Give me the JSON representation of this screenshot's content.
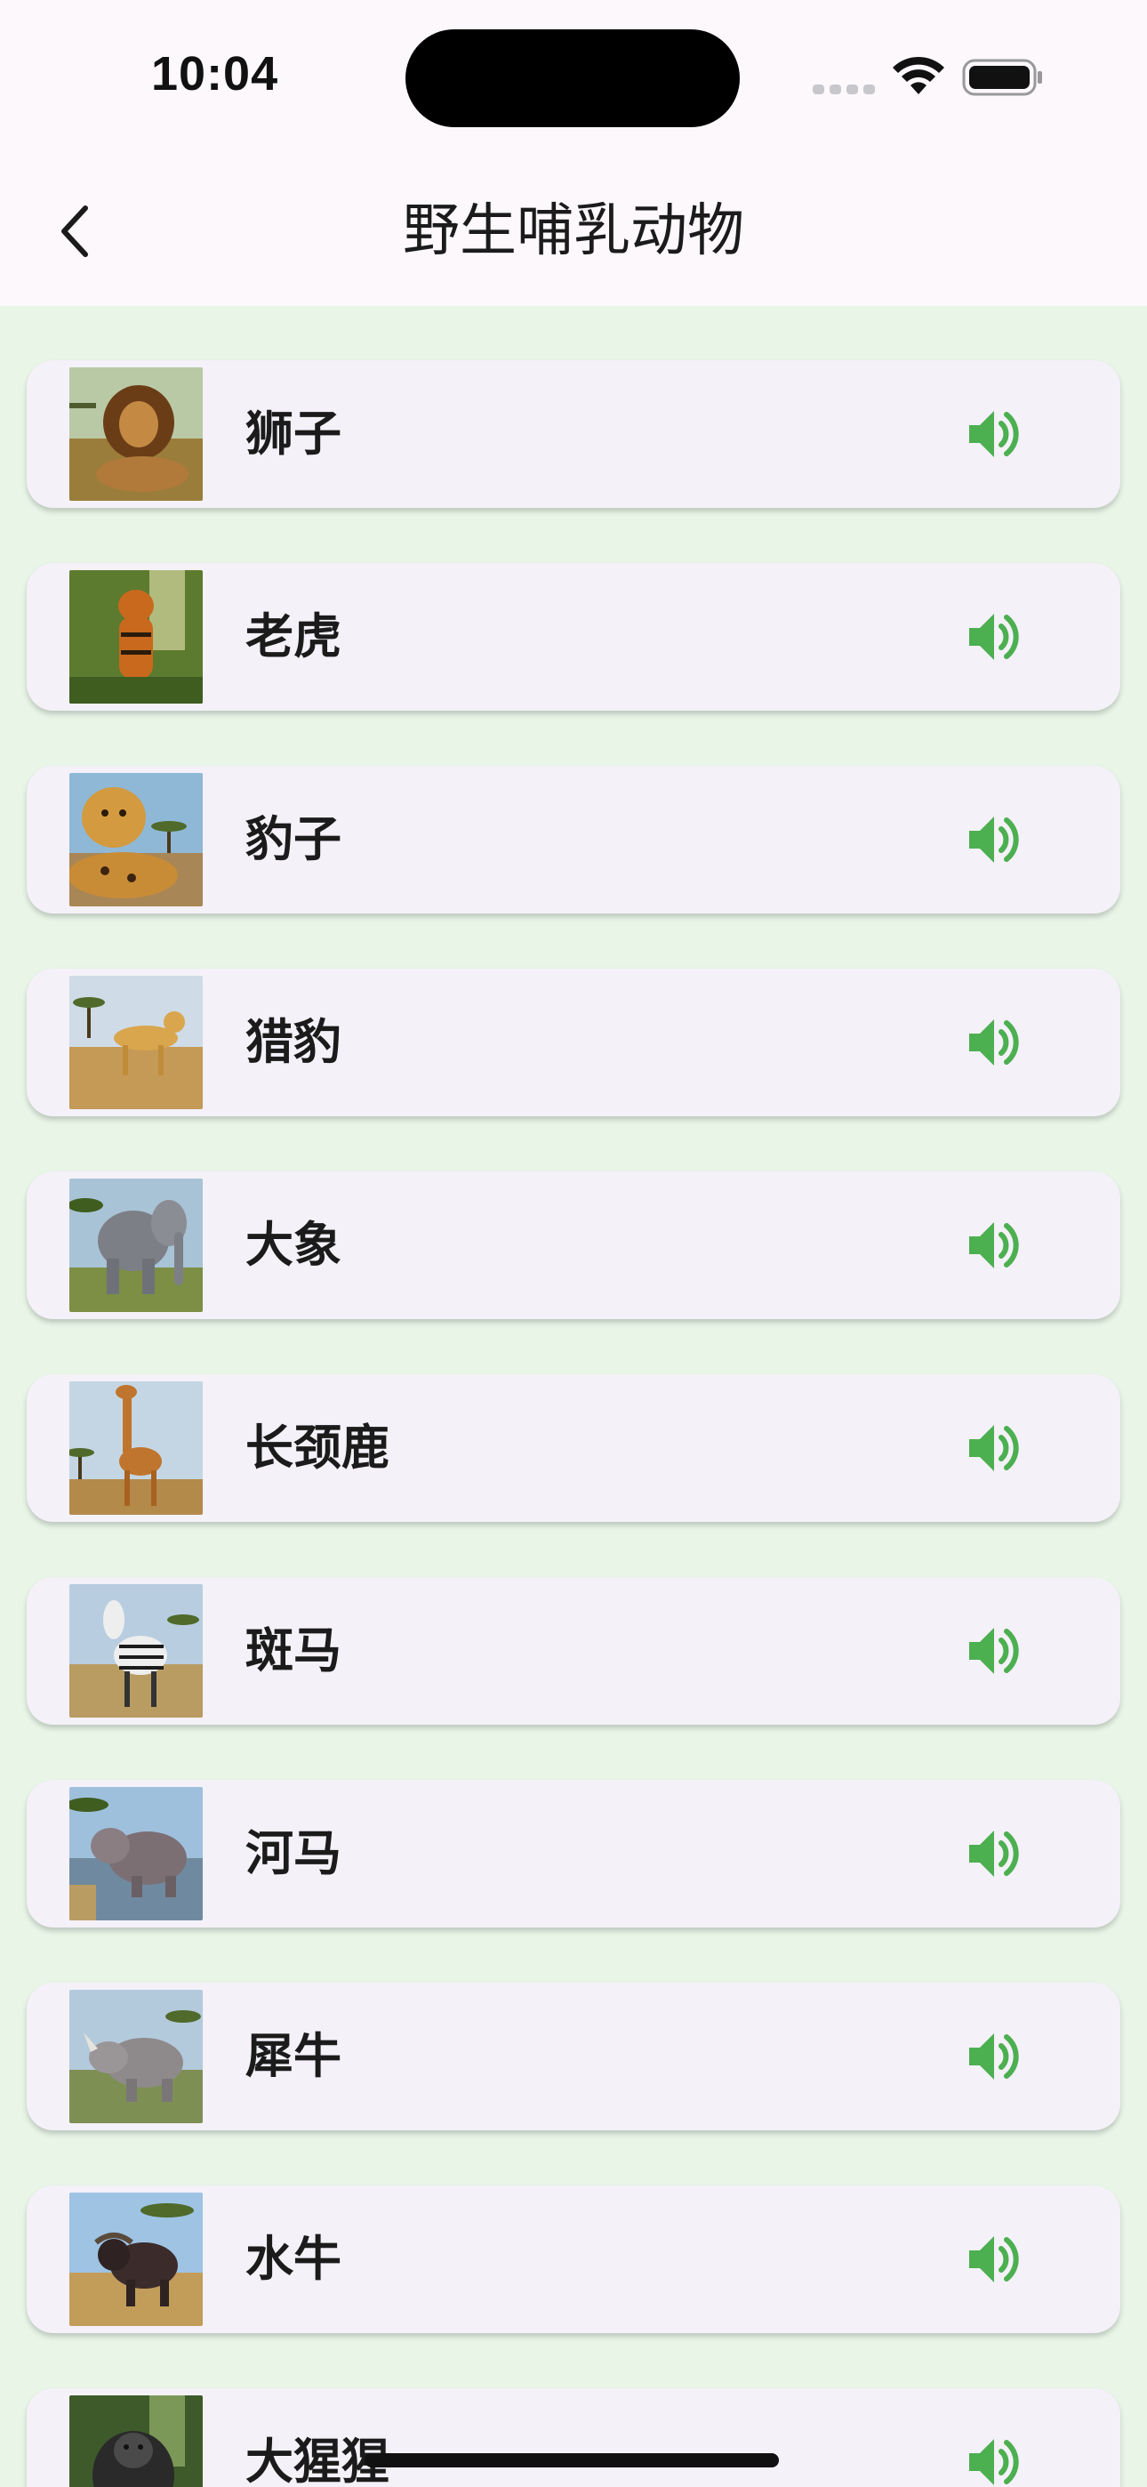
{
  "status_bar": {
    "time": "10:04"
  },
  "header": {
    "title": "野生哺乳动物"
  },
  "icons": {
    "back": "chevron-left-icon",
    "audio": "speaker-volume-icon",
    "wifi": "wifi-icon",
    "battery": "battery-icon"
  },
  "colors": {
    "accent": "#4caf50",
    "page_background": "#e8f5e7",
    "card_background": "#f4f1f8",
    "bar_background": "#fcf8fc"
  },
  "animals": [
    {
      "name": "狮子"
    },
    {
      "name": "老虎"
    },
    {
      "name": "豹子"
    },
    {
      "name": "猎豹"
    },
    {
      "name": "大象"
    },
    {
      "name": "长颈鹿"
    },
    {
      "name": "斑马"
    },
    {
      "name": "河马"
    },
    {
      "name": "犀牛"
    },
    {
      "name": "水牛"
    },
    {
      "name": "大猩猩"
    }
  ]
}
